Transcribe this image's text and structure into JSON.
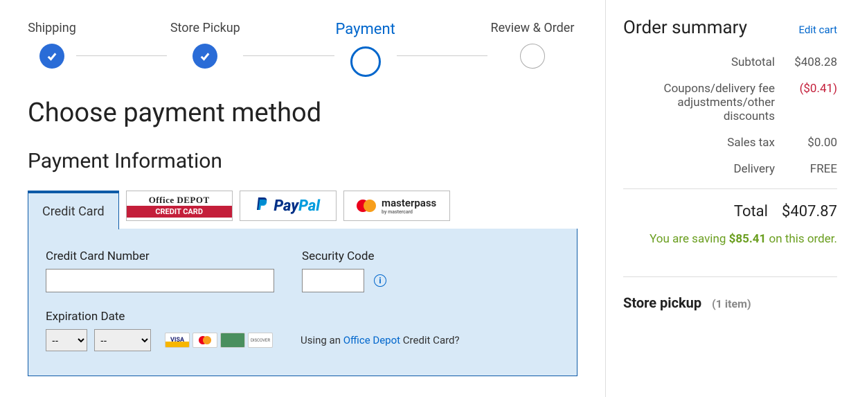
{
  "stepper": {
    "steps": [
      {
        "label": "Shipping",
        "state": "done"
      },
      {
        "label": "Store Pickup",
        "state": "done"
      },
      {
        "label": "Payment",
        "state": "active"
      },
      {
        "label": "Review & Order",
        "state": "later"
      }
    ]
  },
  "page_title": "Choose payment method",
  "section_title": "Payment Information",
  "tabs": {
    "credit_card": "Credit Card",
    "od_top": "Office DEPOT",
    "od_bottom": "CREDIT CARD",
    "paypal_pay": "Pay",
    "paypal_pal": "Pal",
    "masterpass": "masterpass",
    "masterpass_sub": "by mastercard"
  },
  "form": {
    "cc_label": "Credit Card Number",
    "sec_label": "Security Code",
    "exp_label": "Expiration Date",
    "exp_month": "--",
    "exp_year": "--",
    "using_prefix": "Using an ",
    "using_link": "Office Depot",
    "using_suffix": " Credit Card?"
  },
  "summary": {
    "title": "Order summary",
    "edit": "Edit cart",
    "lines": [
      {
        "label": "Subtotal",
        "value": "$408.28"
      },
      {
        "label": "Coupons/delivery fee adjustments/other discounts",
        "value": "($0.41)",
        "discount": true
      },
      {
        "label": "Sales tax",
        "value": "$0.00"
      },
      {
        "label": "Delivery",
        "value": "FREE"
      }
    ],
    "total_label": "Total",
    "total_value": "$407.87",
    "saving_prefix": "You are saving ",
    "saving_amount": "$85.41",
    "saving_suffix": " on this order."
  },
  "pickup": {
    "title": "Store pickup",
    "count": "(1 item)"
  }
}
